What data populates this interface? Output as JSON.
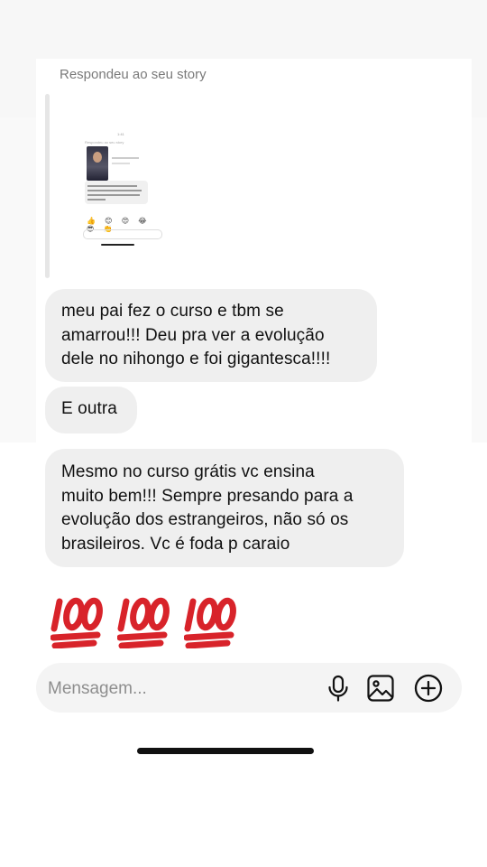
{
  "story": {
    "reply_label": "Respondeu ao seu story",
    "preview_title": "1:41",
    "preview_subtitle": "Respondeu ao seu story",
    "preview_emojis": "👍 😊 😍 😂 😎 👏"
  },
  "messages": [
    {
      "lines": [
        "meu pai fez o curso e tbm se",
        "amarrou!!! Deu pra ver a evolução",
        "dele no nihongo e foi gigantesca!!!!"
      ]
    },
    {
      "lines": [
        "E outra"
      ]
    },
    {
      "lines": [
        "Mesmo no curso grátis vc ensina",
        "muito bem!!! Sempre presando para a",
        "evolução dos estrangeiros, não só os",
        "brasileiros. Vc é foda p caraio"
      ]
    }
  ],
  "reactions": {
    "emoji_name": "hundred-points-icon",
    "count": 3
  },
  "composer": {
    "placeholder": "Mensagem...",
    "icons": [
      "microphone-icon",
      "image-icon",
      "add-circle-icon"
    ]
  },
  "colors": {
    "bubble": "#efefef",
    "hundred_red": "#d8232a",
    "placeholder": "#8e8e8e"
  }
}
